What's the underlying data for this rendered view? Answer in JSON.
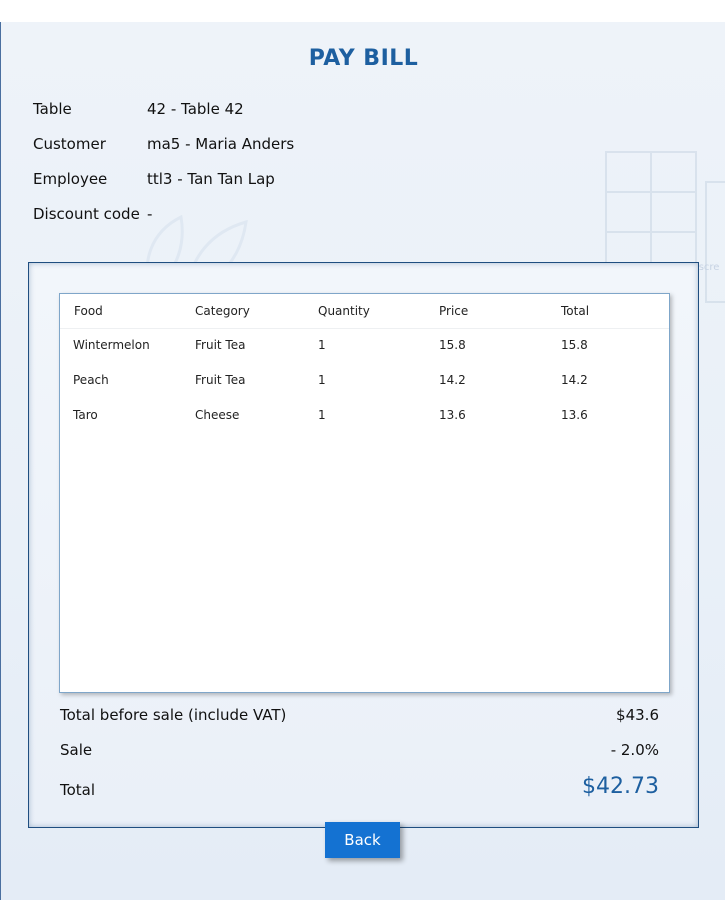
{
  "title": "PAY BILL",
  "info": {
    "table_label": "Table",
    "table_value": "42 - Table 42",
    "customer_label": "Customer",
    "customer_value": "ma5 - Maria Anders",
    "employee_label": "Employee",
    "employee_value": "ttl3 - Tan Tan Lap",
    "discount_label": "Discount code",
    "discount_value": "-"
  },
  "grid": {
    "columns": [
      "Food",
      "Category",
      "Quantity",
      "Price",
      "Total"
    ],
    "rows": [
      [
        "Wintermelon",
        "Fruit Tea",
        "1",
        "15.8",
        "15.8"
      ],
      [
        "Peach",
        "Fruit Tea",
        "1",
        "14.2",
        "14.2"
      ],
      [
        "Taro",
        "Cheese",
        "1",
        "13.6",
        "13.6"
      ]
    ]
  },
  "summary": {
    "before_sale_label": "Total before sale (include VAT)",
    "before_sale_value": "$43.6",
    "sale_label": "Sale",
    "sale_value": "- 2.0%",
    "total_label": "Total",
    "total_value": "$42.73"
  },
  "background_text": "Full-scre",
  "back_label": "Back",
  "colors": {
    "accent": "#1d5fa0",
    "button": "#1472d2",
    "panel_border": "#1f4e80"
  }
}
